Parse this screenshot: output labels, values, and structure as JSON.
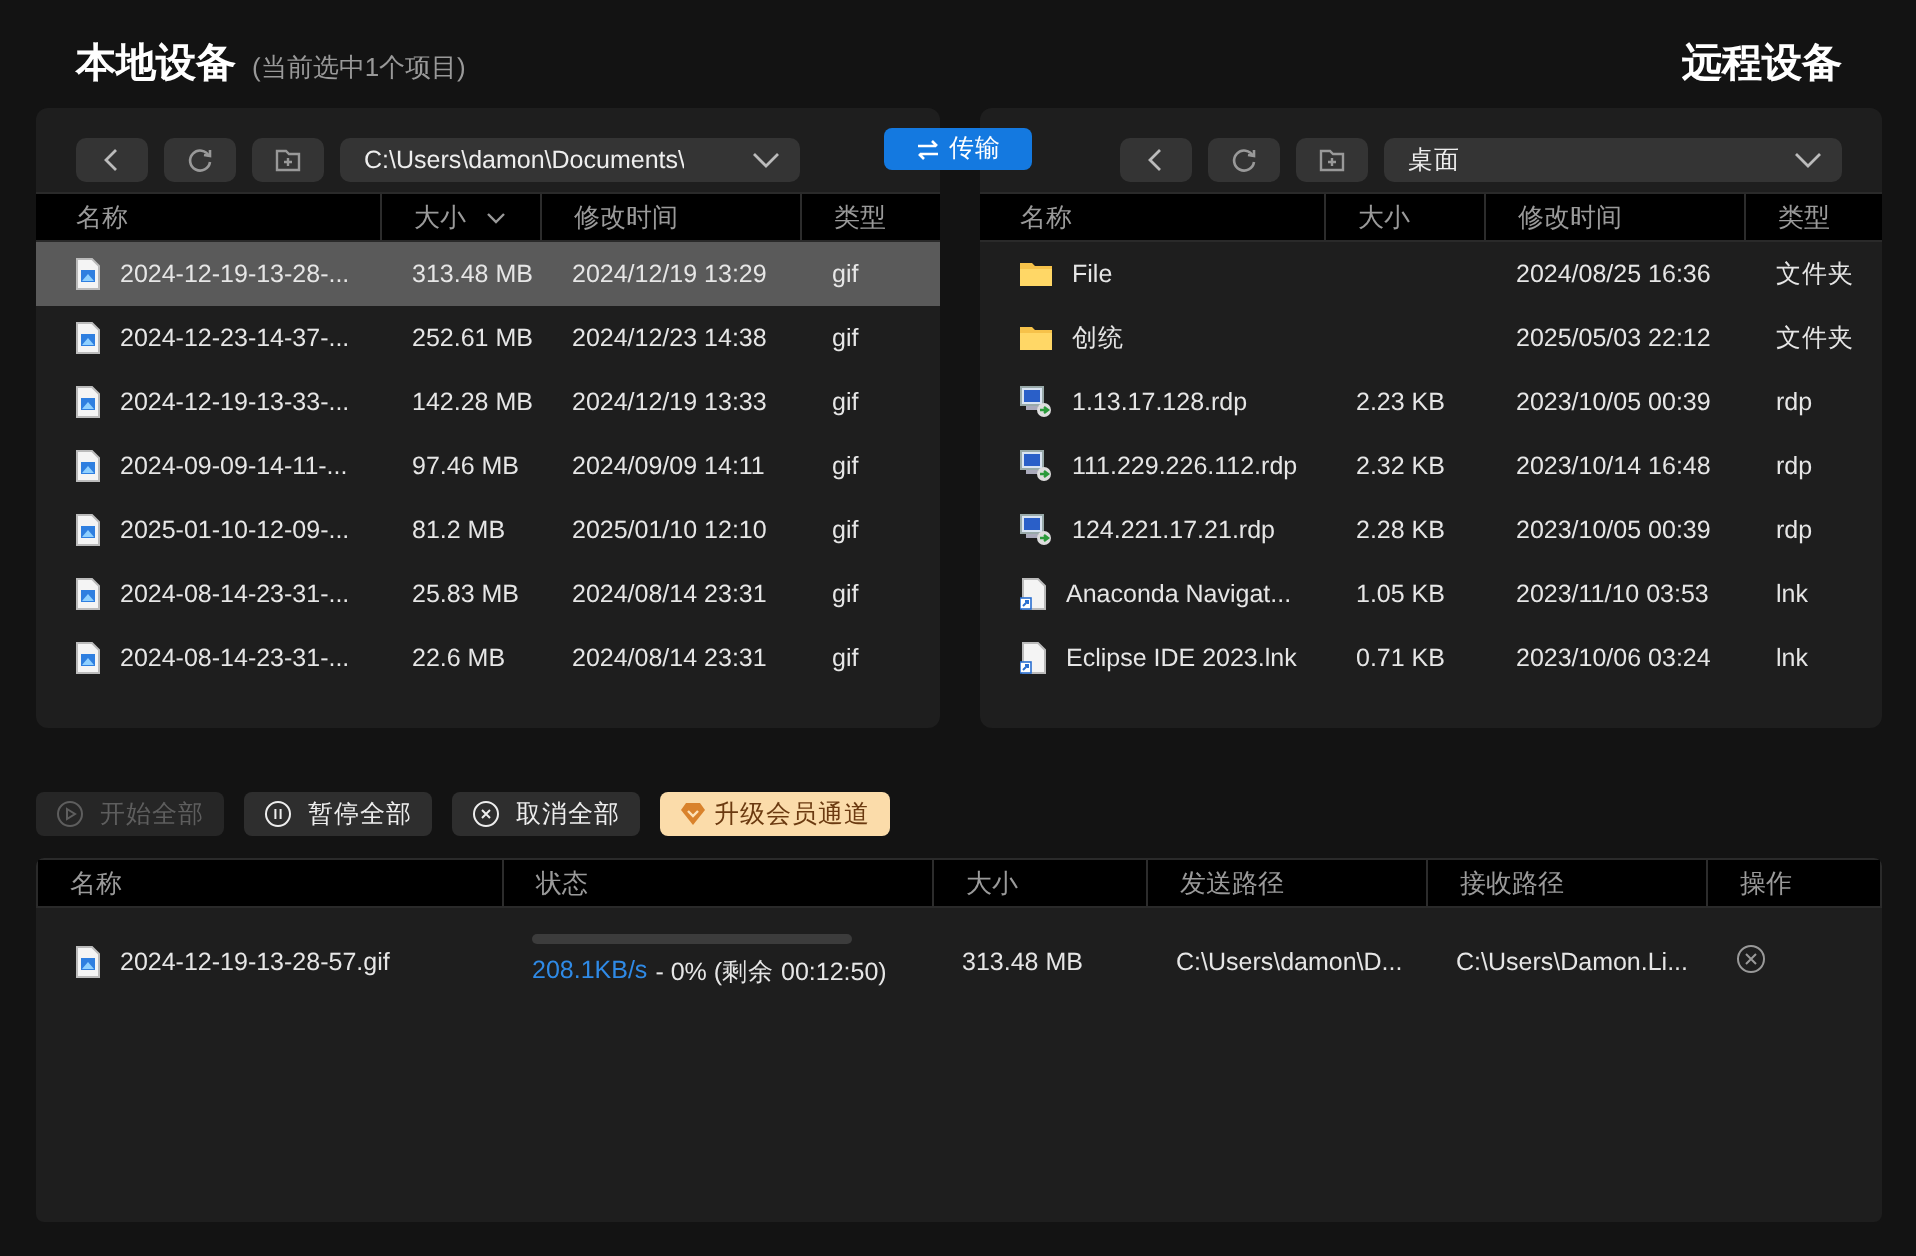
{
  "local": {
    "title": "本地设备",
    "subtitle": "(当前选中1个项目)",
    "path": "C:\\Users\\damon\\Documents\\",
    "columns": [
      {
        "label": "名称",
        "sorted": false
      },
      {
        "label": "大小",
        "sorted": true
      },
      {
        "label": "修改时间",
        "sorted": false
      },
      {
        "label": "类型",
        "sorted": false
      }
    ],
    "rows": [
      {
        "kind": "image",
        "name": "2024-12-19-13-28-...",
        "size": "313.48 MB",
        "time": "2024/12/19 13:29",
        "type": "gif",
        "selected": true
      },
      {
        "kind": "image",
        "name": "2024-12-23-14-37-...",
        "size": "252.61 MB",
        "time": "2024/12/23 14:38",
        "type": "gif",
        "selected": false
      },
      {
        "kind": "image",
        "name": "2024-12-19-13-33-...",
        "size": "142.28 MB",
        "time": "2024/12/19 13:33",
        "type": "gif",
        "selected": false
      },
      {
        "kind": "image",
        "name": "2024-09-09-14-11-...",
        "size": "97.46 MB",
        "time": "2024/09/09 14:11",
        "type": "gif",
        "selected": false
      },
      {
        "kind": "image",
        "name": "2025-01-10-12-09-...",
        "size": "81.2 MB",
        "time": "2025/01/10 12:10",
        "type": "gif",
        "selected": false
      },
      {
        "kind": "image",
        "name": "2024-08-14-23-31-...",
        "size": "25.83 MB",
        "time": "2024/08/14 23:31",
        "type": "gif",
        "selected": false
      },
      {
        "kind": "image",
        "name": "2024-08-14-23-31-...",
        "size": "22.6 MB",
        "time": "2024/08/14 23:31",
        "type": "gif",
        "selected": false
      }
    ]
  },
  "transfer_button": "传输",
  "remote": {
    "title": "远程设备",
    "path": "桌面",
    "columns": [
      {
        "label": "名称",
        "sorted": false
      },
      {
        "label": "大小",
        "sorted": false
      },
      {
        "label": "修改时间",
        "sorted": false
      },
      {
        "label": "类型",
        "sorted": false
      }
    ],
    "rows": [
      {
        "kind": "folder",
        "name": "File",
        "time": "2024/08/25 16:36",
        "type": "文件夹",
        "selected": false
      },
      {
        "kind": "folder",
        "name": "创统",
        "time": "2025/05/03 22:12",
        "type": "文件夹",
        "selected": false
      },
      {
        "kind": "remote",
        "name": "1.13.17.128.rdp",
        "size": "2.23 KB",
        "time": "2023/10/05 00:39",
        "type": "rdp",
        "selected": false
      },
      {
        "kind": "remote",
        "name": "111.229.226.112.rdp",
        "size": "2.32 KB",
        "time": "2023/10/14 16:48",
        "type": "rdp",
        "selected": false
      },
      {
        "kind": "remote",
        "name": "124.221.17.21.rdp",
        "size": "2.28 KB",
        "time": "2023/10/05 00:39",
        "type": "rdp",
        "selected": false
      },
      {
        "kind": "shortcut",
        "name": "Anaconda Navigat...",
        "size": "1.05 KB",
        "time": "2023/11/10 03:53",
        "type": "lnk",
        "selected": false
      },
      {
        "kind": "shortcut",
        "name": "Eclipse IDE 2023.lnk",
        "size": "0.71 KB",
        "time": "2023/10/06 03:24",
        "type": "lnk",
        "selected": false
      }
    ]
  },
  "actions": [
    {
      "kind": "play",
      "label": "开始全部",
      "disabled": true
    },
    {
      "kind": "pause",
      "label": "暂停全部",
      "disabled": false
    },
    {
      "kind": "cancel",
      "label": "取消全部",
      "disabled": false
    },
    {
      "kind": "vip",
      "label": "升级会员通道",
      "disabled": false
    }
  ],
  "transfers": {
    "columns": [
      "名称",
      "状态",
      "大小",
      "发送路径",
      "接收路径",
      "操作"
    ],
    "rows": [
      {
        "kind": "image",
        "name": "2024-12-19-13-28-57.gif",
        "level": 0,
        "speed": "208.1KB/s",
        "status": "- 0% (剩余 00:12:50)",
        "size": "313.48 MB",
        "source": "C:\\Users\\damon\\D...",
        "target": "C:\\Users\\Damon.Li..."
      }
    ]
  }
}
